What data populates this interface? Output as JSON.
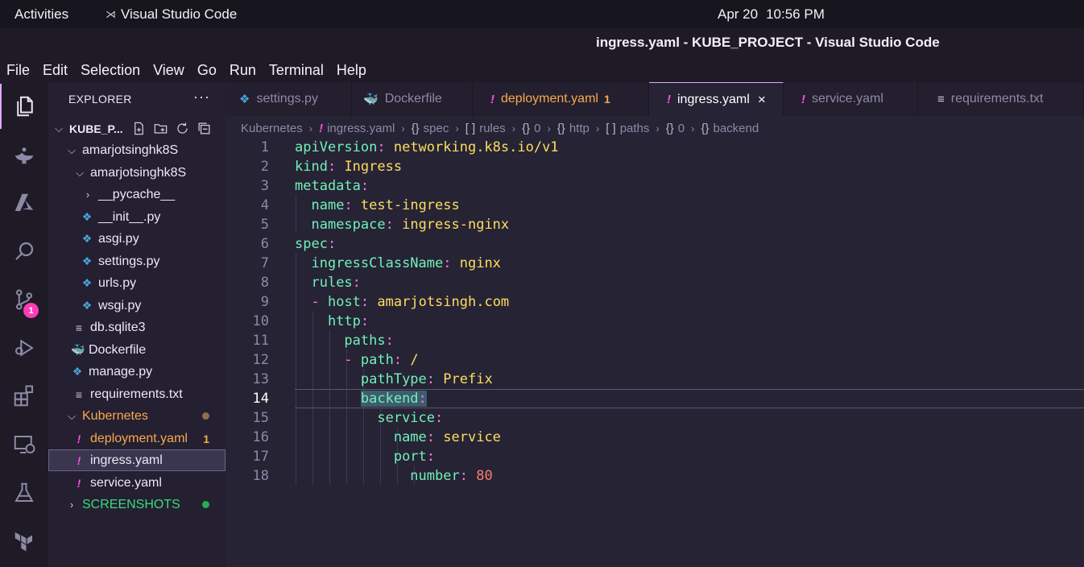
{
  "topbar": {
    "activities": "Activities",
    "app": "Visual Studio Code",
    "date": "Apr 20",
    "time": "10:56 PM"
  },
  "window": {
    "title": "ingress.yaml - KUBE_PROJECT - Visual Studio Code"
  },
  "menu": [
    "File",
    "Edit",
    "Selection",
    "View",
    "Go",
    "Run",
    "Terminal",
    "Help"
  ],
  "activitybar": {
    "scm_badge": "1"
  },
  "explorer": {
    "header": "EXPLORER",
    "more": "···",
    "project": "KUBE_P...",
    "tree": [
      {
        "label": "amarjotsinghk8S"
      },
      {
        "label": "amarjotsinghk8S"
      },
      {
        "label": "__pycache__"
      },
      {
        "label": "__init__.py"
      },
      {
        "label": "asgi.py"
      },
      {
        "label": "settings.py"
      },
      {
        "label": "urls.py"
      },
      {
        "label": "wsgi.py"
      },
      {
        "label": "db.sqlite3"
      },
      {
        "label": "Dockerfile"
      },
      {
        "label": "manage.py"
      },
      {
        "label": "requirements.txt"
      },
      {
        "label": "Kubernetes"
      },
      {
        "label": "deployment.yaml",
        "badge": "1"
      },
      {
        "label": "ingress.yaml"
      },
      {
        "label": "service.yaml"
      },
      {
        "label": "SCREENSHOTS"
      }
    ]
  },
  "tabs": [
    {
      "label": "settings.py"
    },
    {
      "label": "Dockerfile"
    },
    {
      "label": "deployment.yaml",
      "badge": "1"
    },
    {
      "label": "ingress.yaml",
      "close": "×"
    },
    {
      "label": "service.yaml"
    },
    {
      "label": "requirements.txt"
    }
  ],
  "breadcrumb": [
    "Kubernetes",
    "ingress.yaml",
    "spec",
    "rules",
    "0",
    "http",
    "paths",
    "0",
    "backend"
  ],
  "code": [
    {
      "n": "1",
      "key": "apiVersion",
      "val": "networking.k8s.io/v1"
    },
    {
      "n": "2",
      "key": "kind",
      "val": "Ingress"
    },
    {
      "n": "3",
      "key": "metadata",
      "val": ""
    },
    {
      "n": "4",
      "key": "name",
      "val": "test-ingress"
    },
    {
      "n": "5",
      "key": "namespace",
      "val": "ingress-nginx"
    },
    {
      "n": "6",
      "key": "spec",
      "val": ""
    },
    {
      "n": "7",
      "key": "ingressClassName",
      "val": "nginx"
    },
    {
      "n": "8",
      "key": "rules",
      "val": ""
    },
    {
      "n": "9",
      "key": "host",
      "val": "amarjotsingh.com"
    },
    {
      "n": "10",
      "key": "http",
      "val": ""
    },
    {
      "n": "11",
      "key": "paths",
      "val": ""
    },
    {
      "n": "12",
      "key": "path",
      "val": "/"
    },
    {
      "n": "13",
      "key": "pathType",
      "val": "Prefix"
    },
    {
      "n": "14",
      "key": "backend",
      "val": ""
    },
    {
      "n": "15",
      "key": "service",
      "val": ""
    },
    {
      "n": "16",
      "key": "name",
      "val": "service"
    },
    {
      "n": "17",
      "key": "port",
      "val": ""
    },
    {
      "n": "18",
      "key": "number",
      "val": "80"
    }
  ],
  "colors": {
    "accent": "#e5a6ff",
    "yaml_key": "#72f1b8",
    "yaml_value": "#fede5d",
    "yaml_punct": "#ff7edb",
    "yaml_number": "#f97e72",
    "modified_badge": "#f7a94f",
    "scm_badge": "#ff3cb6"
  }
}
